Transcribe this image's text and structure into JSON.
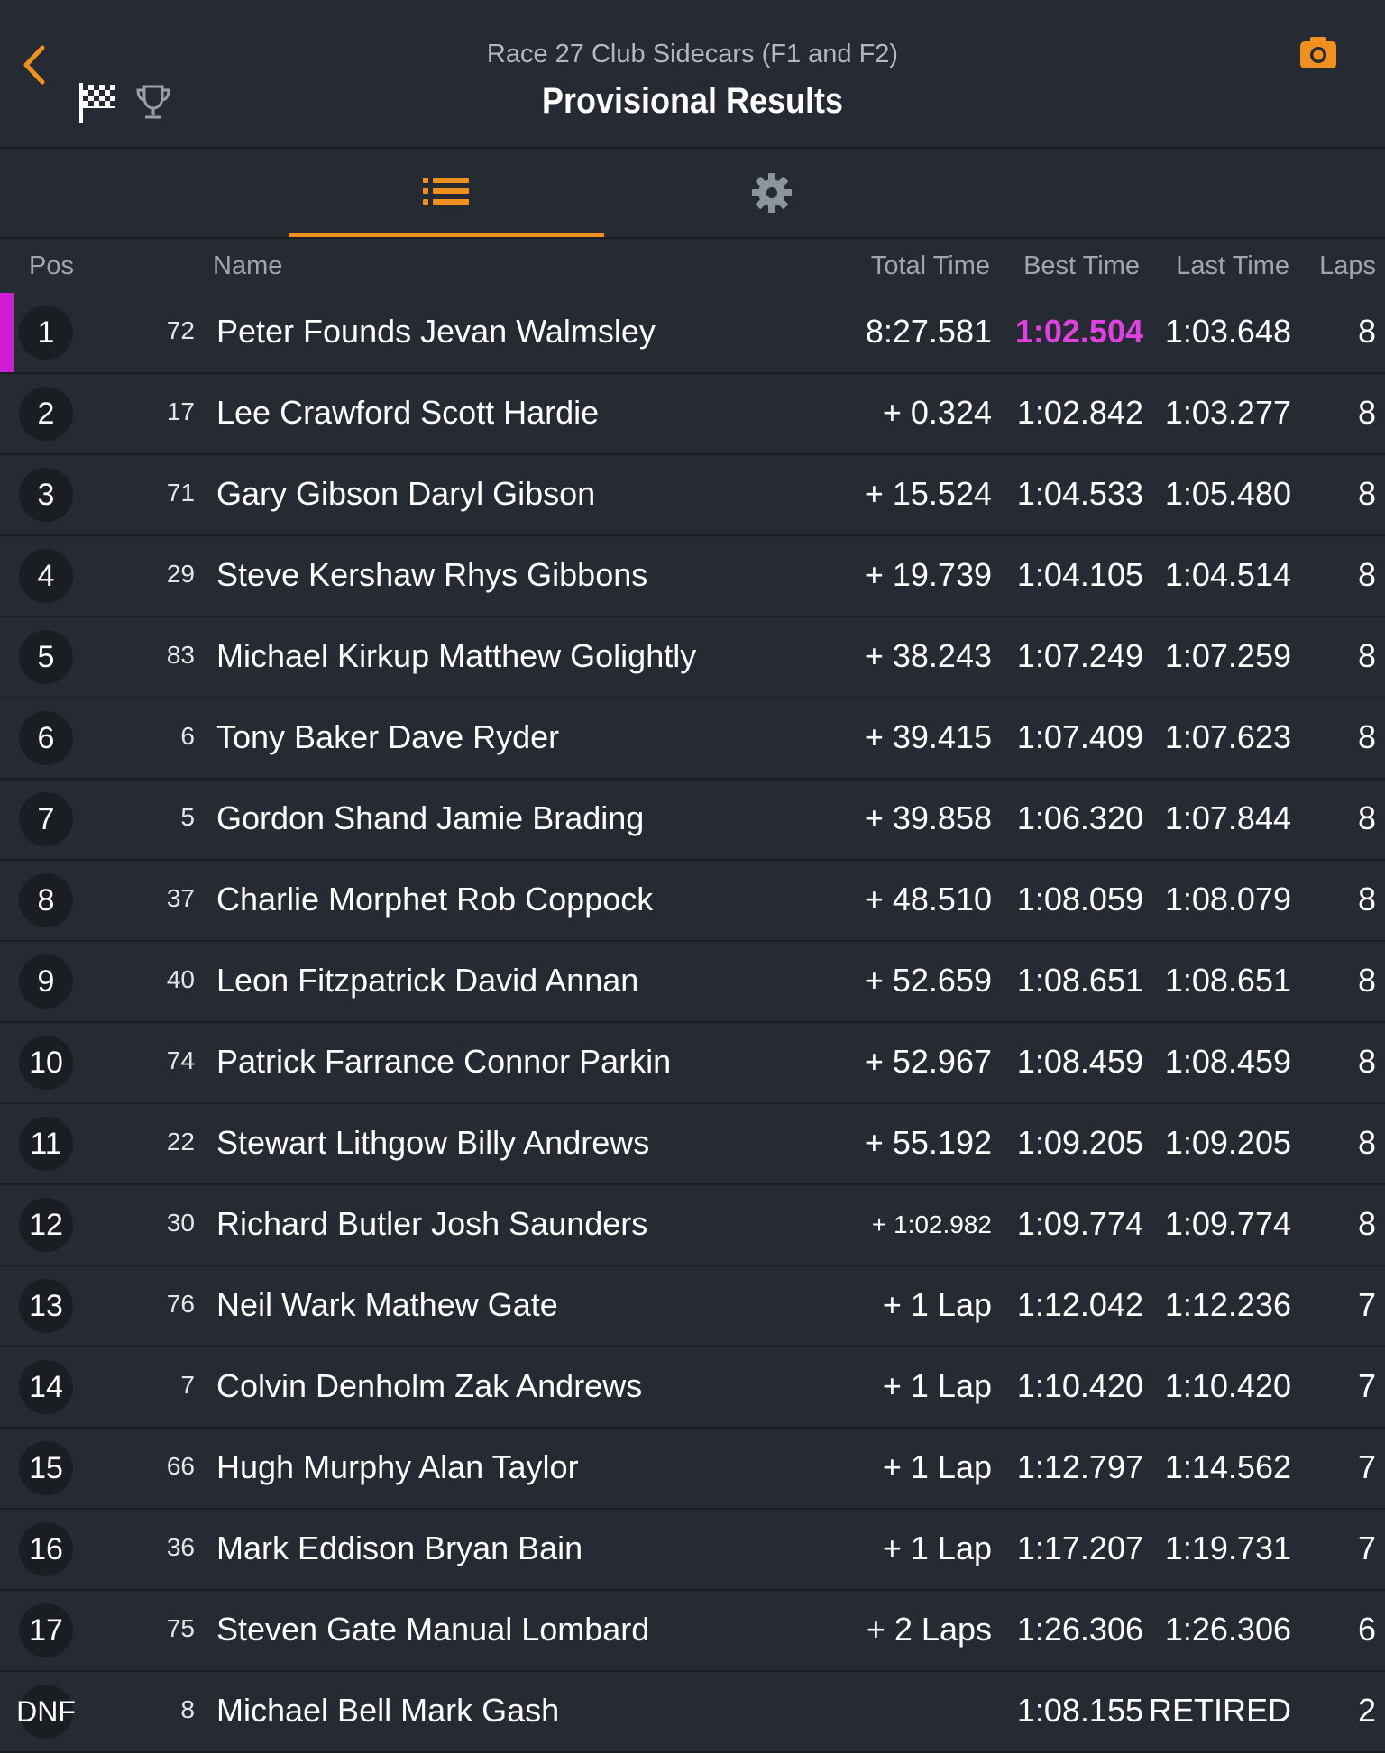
{
  "header": {
    "subtitle": "Race 27 Club Sidecars (F1 and F2)",
    "title": "Provisional Results"
  },
  "icons": {
    "back": "chevron-left-icon",
    "flag": "checkered-flag-icon",
    "trophy": "trophy-icon",
    "camera": "camera-icon",
    "list": "list-icon",
    "gear": "gear-icon"
  },
  "colors": {
    "accent": "#f0901e",
    "fastest": "#e040e0",
    "background": "#262a33"
  },
  "columns": {
    "pos": "Pos",
    "name": "Name",
    "total": "Total Time",
    "best": "Best Time",
    "last": "Last Time",
    "laps": "Laps"
  },
  "rows": [
    {
      "pos": "1",
      "num": "72",
      "name": "Peter Founds Jevan Walmsley",
      "total": "8:27.581",
      "best": "1:02.504",
      "last": "1:03.648",
      "laps": "8"
    },
    {
      "pos": "2",
      "num": "17",
      "name": "Lee Crawford Scott Hardie",
      "total": "+ 0.324",
      "best": "1:02.842",
      "last": "1:03.277",
      "laps": "8"
    },
    {
      "pos": "3",
      "num": "71",
      "name": "Gary Gibson Daryl Gibson",
      "total": "+ 15.524",
      "best": "1:04.533",
      "last": "1:05.480",
      "laps": "8"
    },
    {
      "pos": "4",
      "num": "29",
      "name": "Steve Kershaw Rhys Gibbons",
      "total": "+ 19.739",
      "best": "1:04.105",
      "last": "1:04.514",
      "laps": "8"
    },
    {
      "pos": "5",
      "num": "83",
      "name": "Michael Kirkup Matthew Golightly",
      "total": "+ 38.243",
      "best": "1:07.249",
      "last": "1:07.259",
      "laps": "8"
    },
    {
      "pos": "6",
      "num": "6",
      "name": "Tony Baker Dave Ryder",
      "total": "+ 39.415",
      "best": "1:07.409",
      "last": "1:07.623",
      "laps": "8"
    },
    {
      "pos": "7",
      "num": "5",
      "name": "Gordon Shand Jamie Brading",
      "total": "+ 39.858",
      "best": "1:06.320",
      "last": "1:07.844",
      "laps": "8"
    },
    {
      "pos": "8",
      "num": "37",
      "name": "Charlie Morphet Rob Coppock",
      "total": "+ 48.510",
      "best": "1:08.059",
      "last": "1:08.079",
      "laps": "8"
    },
    {
      "pos": "9",
      "num": "40",
      "name": "Leon Fitzpatrick David Annan",
      "total": "+ 52.659",
      "best": "1:08.651",
      "last": "1:08.651",
      "laps": "8"
    },
    {
      "pos": "10",
      "num": "74",
      "name": "Patrick Farrance Connor Parkin",
      "total": "+ 52.967",
      "best": "1:08.459",
      "last": "1:08.459",
      "laps": "8"
    },
    {
      "pos": "11",
      "num": "22",
      "name": "Stewart Lithgow Billy Andrews",
      "total": "+ 55.192",
      "best": "1:09.205",
      "last": "1:09.205",
      "laps": "8"
    },
    {
      "pos": "12",
      "num": "30",
      "name": "Richard Butler Josh Saunders",
      "total": "+ 1:02.982",
      "best": "1:09.774",
      "last": "1:09.774",
      "laps": "8"
    },
    {
      "pos": "13",
      "num": "76",
      "name": "Neil Wark Mathew Gate",
      "total": "+ 1 Lap",
      "best": "1:12.042",
      "last": "1:12.236",
      "laps": "7"
    },
    {
      "pos": "14",
      "num": "7",
      "name": "Colvin Denholm Zak Andrews",
      "total": "+ 1 Lap",
      "best": "1:10.420",
      "last": "1:10.420",
      "laps": "7"
    },
    {
      "pos": "15",
      "num": "66",
      "name": "Hugh Murphy Alan Taylor",
      "total": "+ 1 Lap",
      "best": "1:12.797",
      "last": "1:14.562",
      "laps": "7"
    },
    {
      "pos": "16",
      "num": "36",
      "name": "Mark Eddison Bryan Bain",
      "total": "+ 1 Lap",
      "best": "1:17.207",
      "last": "1:19.731",
      "laps": "7"
    },
    {
      "pos": "17",
      "num": "75",
      "name": "Steven Gate Manual Lombard",
      "total": "+ 2 Laps",
      "best": "1:26.306",
      "last": "1:26.306",
      "laps": "6"
    },
    {
      "pos": "DNF",
      "num": "8",
      "name": "Michael Bell Mark Gash",
      "total": "",
      "best": "1:08.155",
      "last": "RETIRED",
      "laps": "2"
    }
  ]
}
